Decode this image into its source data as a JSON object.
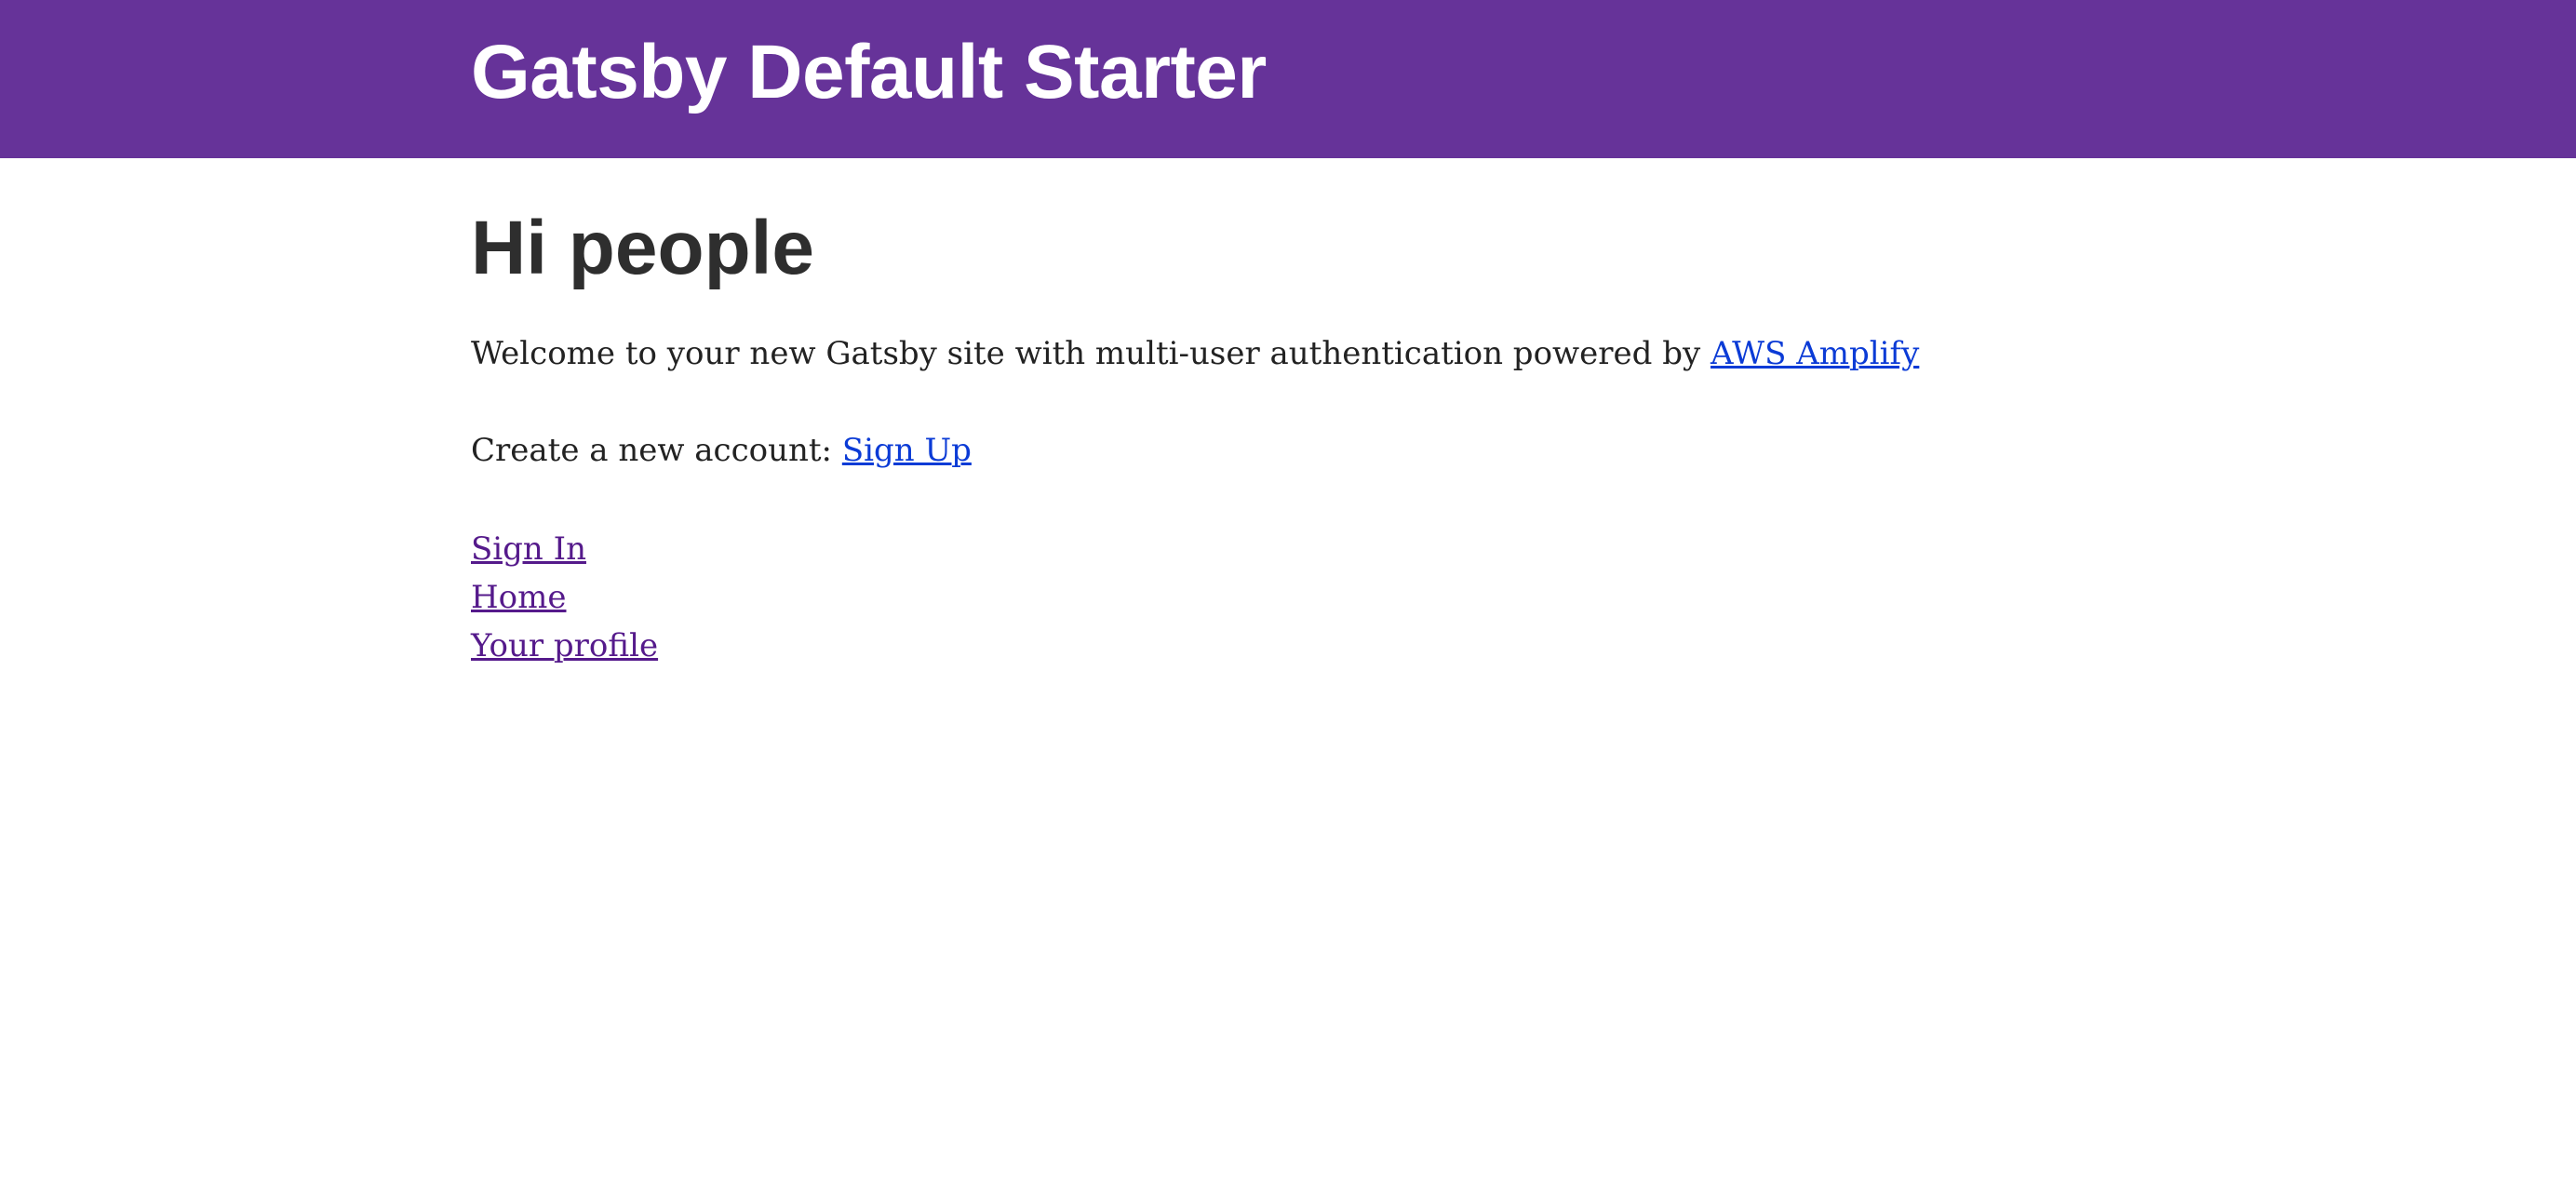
{
  "header": {
    "title": "Gatsby Default Starter"
  },
  "main": {
    "heading": "Hi people",
    "welcome_text": "Welcome to your new Gatsby site with multi-user authentication powered by ",
    "welcome_link": "AWS Amplify",
    "account_text": "Create a new account: ",
    "signup_link": "Sign Up",
    "nav_links": [
      {
        "label": "Sign In"
      },
      {
        "label": "Home"
      },
      {
        "label": "Your profile"
      }
    ]
  },
  "colors": {
    "header_bg": "#663399",
    "link": "#0b3bd6",
    "visited_link": "#551a8b",
    "heading": "#2e2e2e"
  }
}
